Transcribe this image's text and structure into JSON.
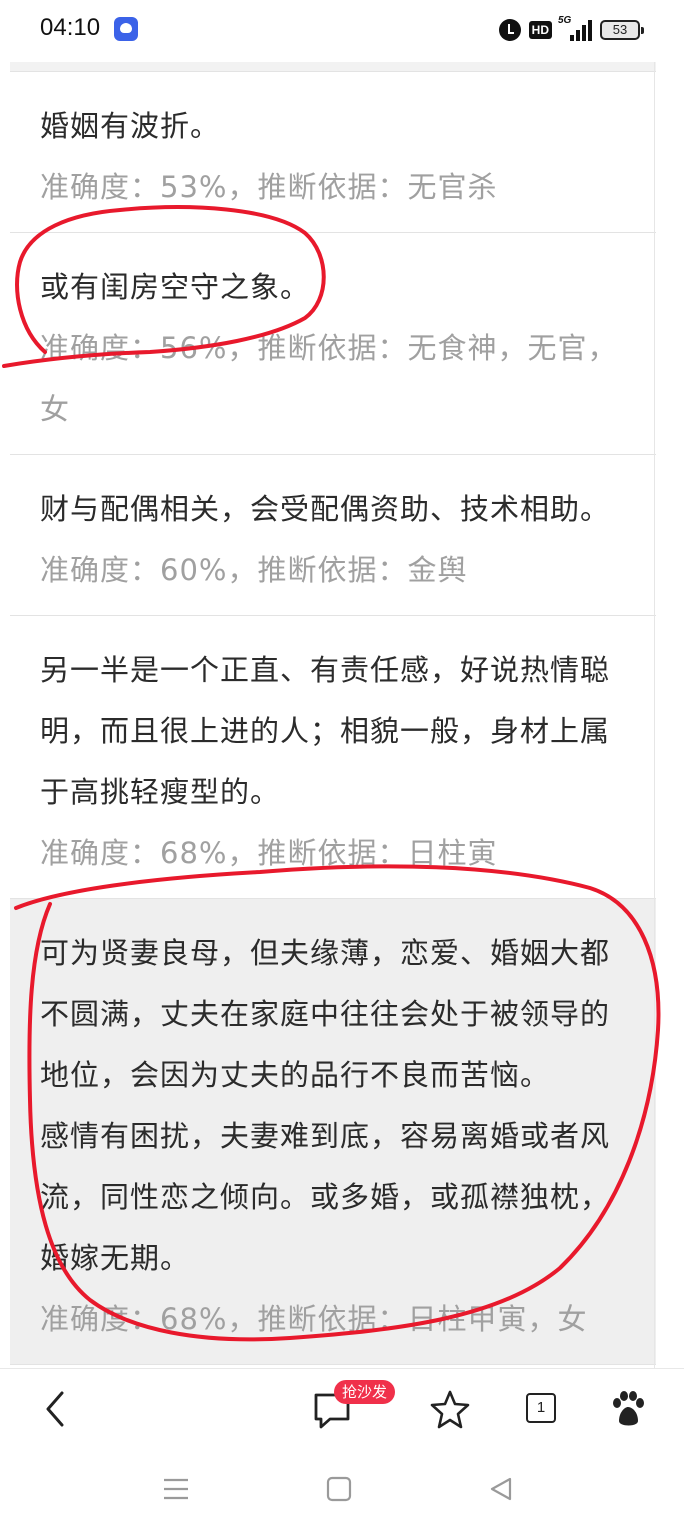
{
  "status_bar": {
    "time": "04:10",
    "battery": "53",
    "indicators": [
      "alarm-icon",
      "hd-icon",
      "5g-signal-icon",
      "battery-icon"
    ],
    "hd_label": "HD",
    "network_label": "5G"
  },
  "results": [
    {
      "text": [
        "婚姻有波折。"
      ],
      "meta": "准确度：53%，推断依据：无官杀",
      "highlighted": false
    },
    {
      "text": [
        "或有闺房空守之象。"
      ],
      "meta": "准确度：56%，推断依据：无食神，无官，女",
      "highlighted": false
    },
    {
      "text": [
        "财与配偶相关，会受配偶资助、技术相助。"
      ],
      "meta": "准确度：60%，推断依据：金舆",
      "highlighted": false
    },
    {
      "text": [
        "另一半是一个正直、有责任感，好说热情聪明，而且很上进的人；相貌一般，身材上属于高挑轻瘦型的。"
      ],
      "meta": "准确度：68%，推断依据：日柱寅",
      "highlighted": false
    },
    {
      "text": [
        "可为贤妻良母，但夫缘薄，恋爱、婚姻大都不圆满，丈夫在家庭中往往会处于被领导的地位，会因为丈夫的品行不良而苦恼。",
        "感情有困扰，夫妻难到底，容易离婚或者风流，同性恋之倾向。或多婚，或孤襟独枕，婚嫁无期。"
      ],
      "meta": "准确度：68%，推断依据：日柱甲寅，女",
      "highlighted": true
    }
  ],
  "toolbar": {
    "comment_badge": "抢沙发",
    "tab_count": "1",
    "icons": [
      "back-icon",
      "comment-icon",
      "star-icon",
      "tabs-icon",
      "baidu-paw-icon"
    ]
  },
  "navbar": {
    "icons": [
      "menu-icon",
      "home-icon",
      "back-triangle-icon"
    ]
  },
  "colors": {
    "annotation": "#e8192c",
    "badge": "#f0304a",
    "meta_text": "#a0a0a0",
    "highlight_bg": "#efefef"
  }
}
